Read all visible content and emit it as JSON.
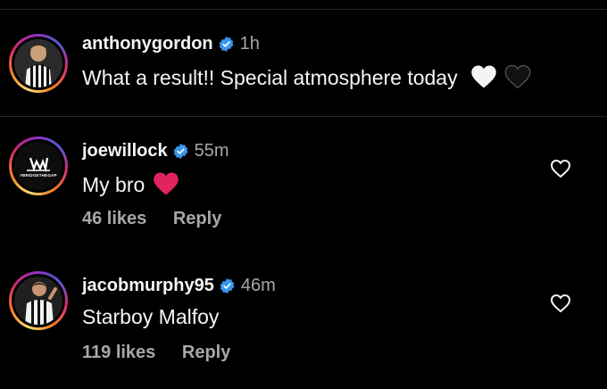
{
  "colors": {
    "background": "#000000",
    "text": "#f5f5f5",
    "muted": "#a8a8a8",
    "verified": "#3897f0",
    "divider": "#262626",
    "red_heart": "#e0245e"
  },
  "comments": [
    {
      "username": "anthonygordon",
      "verified_icon": "verified-badge-icon",
      "time": "1h",
      "text": "What a result!! Special atmosphere today",
      "emojis": [
        "white-heart-icon",
        "black-heart-icon"
      ]
    },
    {
      "username": "joewillock",
      "verified_icon": "verified-badge-icon",
      "time": "55m",
      "text": "My bro",
      "emojis": [
        "red-heart-icon"
      ],
      "avatar_text": "#BRIDGETHEGAP",
      "likes": "46 likes",
      "reply": "Reply",
      "like_icon": "heart-outline-icon"
    },
    {
      "username": "jacobmurphy95",
      "verified_icon": "verified-badge-icon",
      "time": "46m",
      "text": "Starboy Malfoy",
      "likes": "119 likes",
      "reply": "Reply",
      "like_icon": "heart-outline-icon"
    }
  ]
}
